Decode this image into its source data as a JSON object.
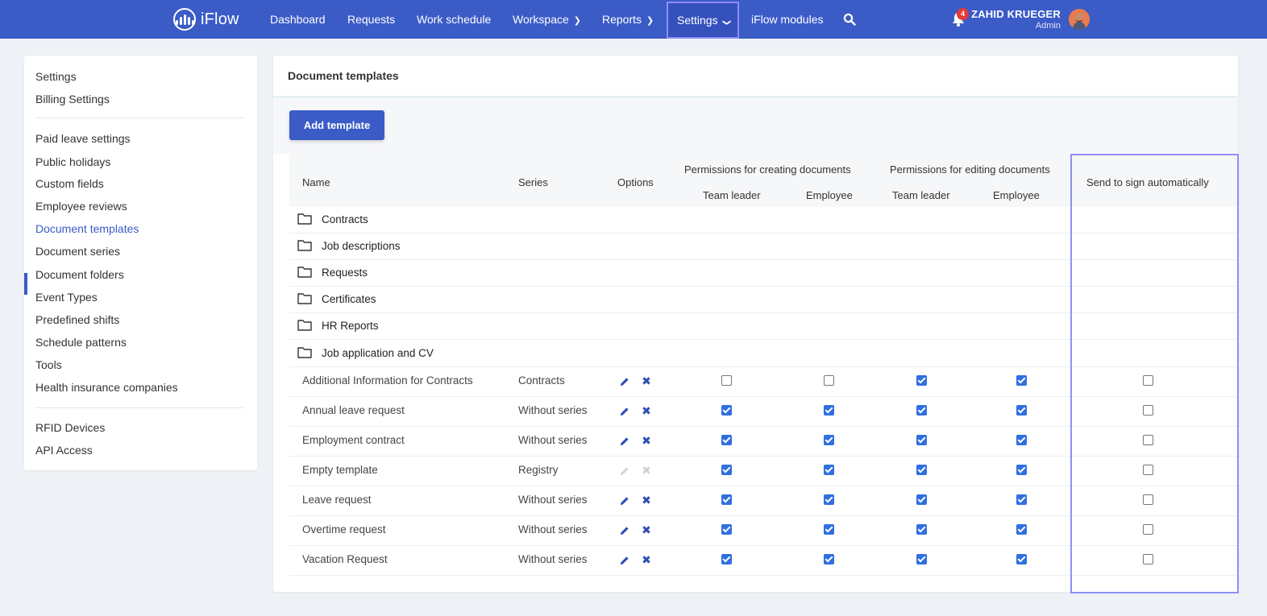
{
  "app": {
    "name": "iFlow"
  },
  "nav": {
    "dashboard": "Dashboard",
    "requests": "Requests",
    "work_schedule": "Work schedule",
    "workspace": "Workspace",
    "reports": "Reports",
    "settings": "Settings",
    "iflow_modules": "iFlow modules"
  },
  "user": {
    "name": "ZAHID KRUEGER",
    "role": "Admin",
    "notifications": "4"
  },
  "sidebar": {
    "items": [
      "Settings",
      "Billing Settings",
      "Paid leave settings",
      "Public holidays",
      "Custom fields",
      "Employee reviews",
      "Document templates",
      "Document series",
      "Document folders",
      "Event Types",
      "Predefined shifts",
      "Schedule patterns",
      "Tools",
      "Health insurance companies",
      "RFID Devices",
      "API Access"
    ],
    "active": "Document templates"
  },
  "page": {
    "title": "Document templates",
    "add_button": "Add template"
  },
  "table": {
    "headers": {
      "name": "Name",
      "series": "Series",
      "options": "Options",
      "perm_create": "Permissions for creating documents",
      "perm_edit": "Permissions for editing documents",
      "team_leader": "Team leader",
      "employee": "Employee",
      "send_sign": "Send to sign automatically"
    },
    "folders": [
      "Contracts",
      "Job descriptions",
      "Requests",
      "Certificates",
      "HR Reports",
      "Job application and CV"
    ],
    "rows": [
      {
        "name": "Additional Information for Contracts",
        "series": "Contracts",
        "editable": true,
        "create_tl": false,
        "create_emp": false,
        "edit_tl": true,
        "edit_emp": true,
        "send_sign": false
      },
      {
        "name": "Annual leave request",
        "series": "Without series",
        "editable": true,
        "create_tl": true,
        "create_emp": true,
        "edit_tl": true,
        "edit_emp": true,
        "send_sign": false
      },
      {
        "name": "Employment contract",
        "series": "Without series",
        "editable": true,
        "create_tl": true,
        "create_emp": true,
        "edit_tl": true,
        "edit_emp": true,
        "send_sign": false
      },
      {
        "name": "Empty template",
        "series": "Registry",
        "editable": false,
        "create_tl": true,
        "create_emp": true,
        "edit_tl": true,
        "edit_emp": true,
        "send_sign": false
      },
      {
        "name": "Leave request",
        "series": "Without series",
        "editable": true,
        "create_tl": true,
        "create_emp": true,
        "edit_tl": true,
        "edit_emp": true,
        "send_sign": false
      },
      {
        "name": "Overtime request",
        "series": "Without series",
        "editable": true,
        "create_tl": true,
        "create_emp": true,
        "edit_tl": true,
        "edit_emp": true,
        "send_sign": false
      },
      {
        "name": "Vacation Request",
        "series": "Without series",
        "editable": true,
        "create_tl": true,
        "create_emp": true,
        "edit_tl": true,
        "edit_emp": true,
        "send_sign": false
      }
    ]
  },
  "colors": {
    "brand": "#3b5bc7",
    "checkbox": "#2f6fe0",
    "highlight": "#8d8ff7"
  }
}
